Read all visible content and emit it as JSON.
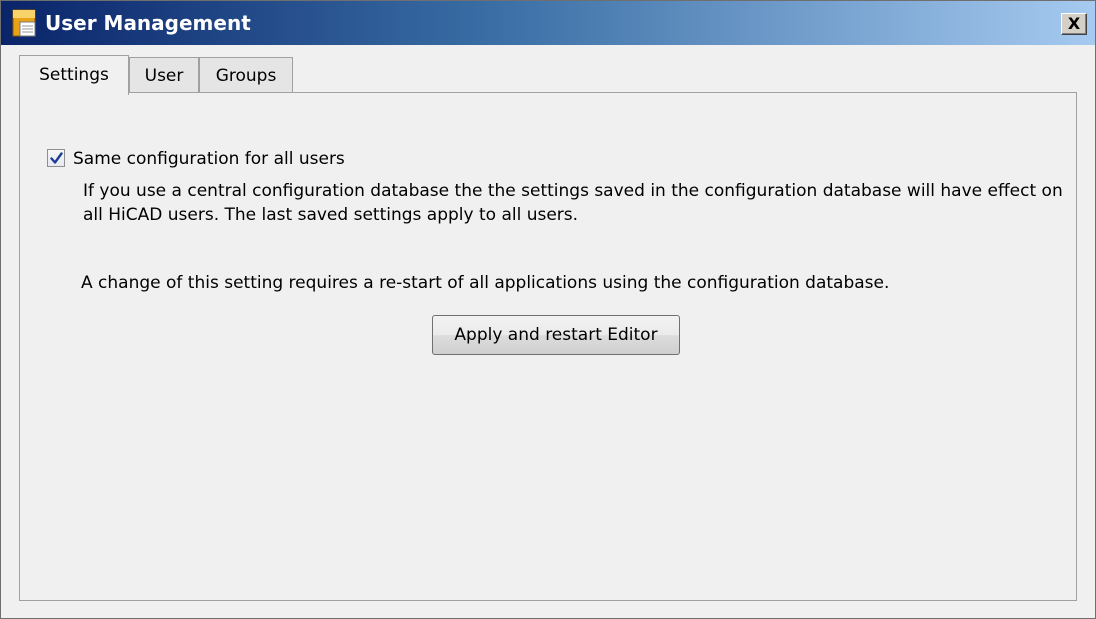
{
  "window": {
    "title": "User Management",
    "close_label": "X",
    "app_icon": "hicad-app-icon"
  },
  "tabs": [
    {
      "label": "Settings",
      "active": true
    },
    {
      "label": "User",
      "active": false
    },
    {
      "label": "Groups",
      "active": false
    }
  ],
  "settings": {
    "same_config": {
      "label": "Same configuration for all users",
      "checked": true
    },
    "description": "If you use a central configuration database the the settings saved in the configuration database will have effect on all HiCAD users. The last saved settings apply to all users.",
    "restart_note": "A change of this setting requires a re-start of all applications using the configuration database.",
    "apply_button": "Apply and restart Editor"
  },
  "colors": {
    "title_gradient_start": "#0a246a",
    "title_gradient_end": "#a6caf0",
    "window_bg": "#f0f0f0",
    "checkmark": "#1c3f95"
  }
}
